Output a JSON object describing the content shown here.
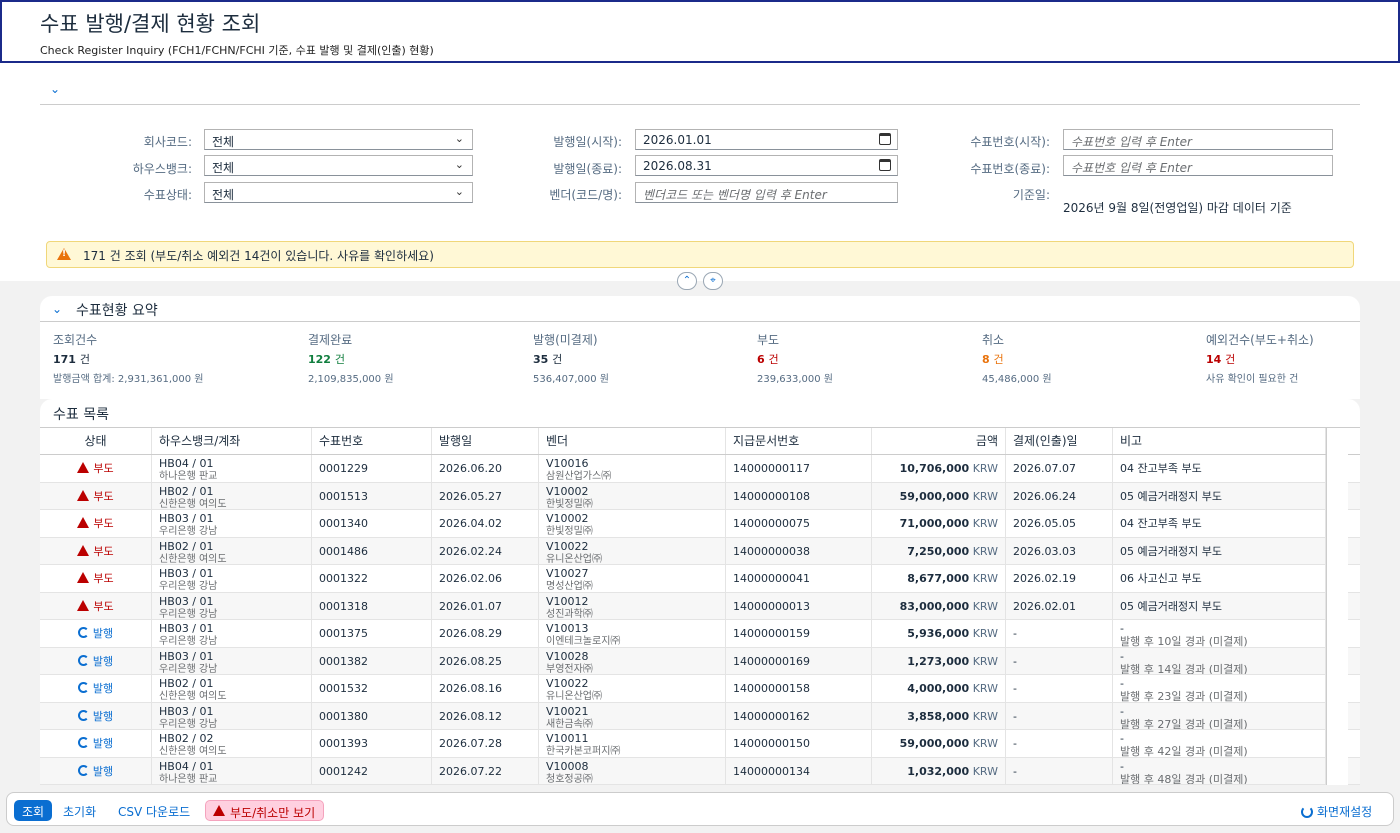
{
  "header": {
    "title": "수표 발행/결제 현황 조회",
    "subtitle": "Check Register Inquiry (FCH1/FCHN/FCHI 기준, 수표 발행 및 결제(인출) 현황)"
  },
  "filters": {
    "company_label": "회사코드:",
    "company_value": "전체",
    "housebank_label": "하우스뱅크:",
    "housebank_value": "전체",
    "status_label": "수표상태:",
    "status_value": "전체",
    "issue_from_label": "발행일(시작):",
    "issue_from_value": "2026.01.01",
    "issue_to_label": "발행일(종료):",
    "issue_to_value": "2026.08.31",
    "vendor_label": "벤더(코드/명):",
    "vendor_placeholder": "벤더코드 또는 벤더명 입력 후 Enter",
    "check_from_label": "수표번호(시작):",
    "check_from_placeholder": "수표번호 입력 후 Enter",
    "check_to_label": "수표번호(종료):",
    "check_to_placeholder": "수표번호 입력 후 Enter",
    "basedate_label": "기준일:",
    "basedate_value": "2026년 9월 8일(전영업일) 마감 데이터 기준"
  },
  "warning": "171 건 조회 (부도/취소 예외건 14건이 있습니다. 사유를 확인하세요)",
  "summary": {
    "title": "수표현황 요약",
    "kpis": [
      {
        "title": "조회건수",
        "value": "171",
        "unit": "건",
        "sub": "발행금액 합계: 2,931,361,000 원",
        "color": "#1d2d3e"
      },
      {
        "title": "결제완료",
        "value": "122",
        "unit": "건",
        "sub": "2,109,835,000 원",
        "color": "#107e3e"
      },
      {
        "title": "발행(미결제)",
        "value": "35",
        "unit": "건",
        "sub": "536,407,000 원",
        "color": "#1d2d3e"
      },
      {
        "title": "부도",
        "value": "6",
        "unit": "건",
        "sub": "239,633,000 원",
        "color": "#bb0000"
      },
      {
        "title": "취소",
        "value": "8",
        "unit": "건",
        "sub": "45,486,000 원",
        "color": "#e9730c"
      },
      {
        "title": "예외건수(부도+취소)",
        "value": "14",
        "unit": "건",
        "sub": "사유 확인이 필요한 건",
        "color": "#bb0000"
      }
    ]
  },
  "list": {
    "title": "수표 목록",
    "columns": [
      "상태",
      "하우스뱅크/계좌",
      "수표번호",
      "발행일",
      "벤더",
      "지급문서번호",
      "금액",
      "결제(인출)일",
      "비고"
    ],
    "rows": [
      {
        "status": "부도",
        "kind": "bad",
        "bank": "HB04 / 01",
        "bank2": "하나은행 판교",
        "check": "0001229",
        "date": "2026.06.20",
        "vendor": "V10016",
        "vendor2": "삼원산업가스㈜",
        "doc": "14000000117",
        "amount": "10,706,000",
        "cur": "KRW",
        "paid": "2026.07.07",
        "note": "04 잔고부족 부도",
        "note2": ""
      },
      {
        "status": "부도",
        "kind": "bad",
        "bank": "HB02 / 01",
        "bank2": "신한은행 여의도",
        "check": "0001513",
        "date": "2026.05.27",
        "vendor": "V10002",
        "vendor2": "한빛정밀㈜",
        "doc": "14000000108",
        "amount": "59,000,000",
        "cur": "KRW",
        "paid": "2026.06.24",
        "note": "05 예금거래정지 부도",
        "note2": ""
      },
      {
        "status": "부도",
        "kind": "bad",
        "bank": "HB03 / 01",
        "bank2": "우리은행 강남",
        "check": "0001340",
        "date": "2026.04.02",
        "vendor": "V10002",
        "vendor2": "한빛정밀㈜",
        "doc": "14000000075",
        "amount": "71,000,000",
        "cur": "KRW",
        "paid": "2026.05.05",
        "note": "04 잔고부족 부도",
        "note2": ""
      },
      {
        "status": "부도",
        "kind": "bad",
        "bank": "HB02 / 01",
        "bank2": "신한은행 여의도",
        "check": "0001486",
        "date": "2026.02.24",
        "vendor": "V10022",
        "vendor2": "유니온산업㈜",
        "doc": "14000000038",
        "amount": "7,250,000",
        "cur": "KRW",
        "paid": "2026.03.03",
        "note": "05 예금거래정지 부도",
        "note2": ""
      },
      {
        "status": "부도",
        "kind": "bad",
        "bank": "HB03 / 01",
        "bank2": "우리은행 강남",
        "check": "0001322",
        "date": "2026.02.06",
        "vendor": "V10027",
        "vendor2": "명성산업㈜",
        "doc": "14000000041",
        "amount": "8,677,000",
        "cur": "KRW",
        "paid": "2026.02.19",
        "note": "06 사고신고 부도",
        "note2": ""
      },
      {
        "status": "부도",
        "kind": "bad",
        "bank": "HB03 / 01",
        "bank2": "우리은행 강남",
        "check": "0001318",
        "date": "2026.01.07",
        "vendor": "V10012",
        "vendor2": "성진과학㈜",
        "doc": "14000000013",
        "amount": "83,000,000",
        "cur": "KRW",
        "paid": "2026.02.01",
        "note": "05 예금거래정지 부도",
        "note2": ""
      },
      {
        "status": "발행",
        "kind": "ok",
        "bank": "HB03 / 01",
        "bank2": "우리은행 강남",
        "check": "0001375",
        "date": "2026.08.29",
        "vendor": "V10013",
        "vendor2": "이엔테크놀로지㈜",
        "doc": "14000000159",
        "amount": "5,936,000",
        "cur": "KRW",
        "paid": "-",
        "note": "-",
        "note2": "발행 후 10일 경과 (미결제)"
      },
      {
        "status": "발행",
        "kind": "ok",
        "bank": "HB03 / 01",
        "bank2": "우리은행 강남",
        "check": "0001382",
        "date": "2026.08.25",
        "vendor": "V10028",
        "vendor2": "부영전자㈜",
        "doc": "14000000169",
        "amount": "1,273,000",
        "cur": "KRW",
        "paid": "-",
        "note": "-",
        "note2": "발행 후 14일 경과 (미결제)"
      },
      {
        "status": "발행",
        "kind": "ok",
        "bank": "HB02 / 01",
        "bank2": "신한은행 여의도",
        "check": "0001532",
        "date": "2026.08.16",
        "vendor": "V10022",
        "vendor2": "유니온산업㈜",
        "doc": "14000000158",
        "amount": "4,000,000",
        "cur": "KRW",
        "paid": "-",
        "note": "-",
        "note2": "발행 후 23일 경과 (미결제)"
      },
      {
        "status": "발행",
        "kind": "ok",
        "bank": "HB03 / 01",
        "bank2": "우리은행 강남",
        "check": "0001380",
        "date": "2026.08.12",
        "vendor": "V10021",
        "vendor2": "새한금속㈜",
        "doc": "14000000162",
        "amount": "3,858,000",
        "cur": "KRW",
        "paid": "-",
        "note": "-",
        "note2": "발행 후 27일 경과 (미결제)"
      },
      {
        "status": "발행",
        "kind": "ok",
        "bank": "HB02 / 02",
        "bank2": "신한은행 여의도",
        "check": "0001393",
        "date": "2026.07.28",
        "vendor": "V10011",
        "vendor2": "한국카본코퍼지㈜",
        "doc": "14000000150",
        "amount": "59,000,000",
        "cur": "KRW",
        "paid": "-",
        "note": "-",
        "note2": "발행 후 42일 경과 (미결제)",
        "warn": true
      },
      {
        "status": "발행",
        "kind": "ok",
        "bank": "HB04 / 01",
        "bank2": "하나은행 판교",
        "check": "0001242",
        "date": "2026.07.22",
        "vendor": "V10008",
        "vendor2": "청호정공㈜",
        "doc": "14000000134",
        "amount": "1,032,000",
        "cur": "KRW",
        "paid": "-",
        "note": "-",
        "note2": "발행 후 48일 경과 (미결제)",
        "warn": true
      }
    ]
  },
  "footer": {
    "search": "조회",
    "reset": "초기화",
    "csv": "CSV 다운로드",
    "exceptions": "부도/취소만 보기",
    "layout_reset": "화면재설정"
  }
}
